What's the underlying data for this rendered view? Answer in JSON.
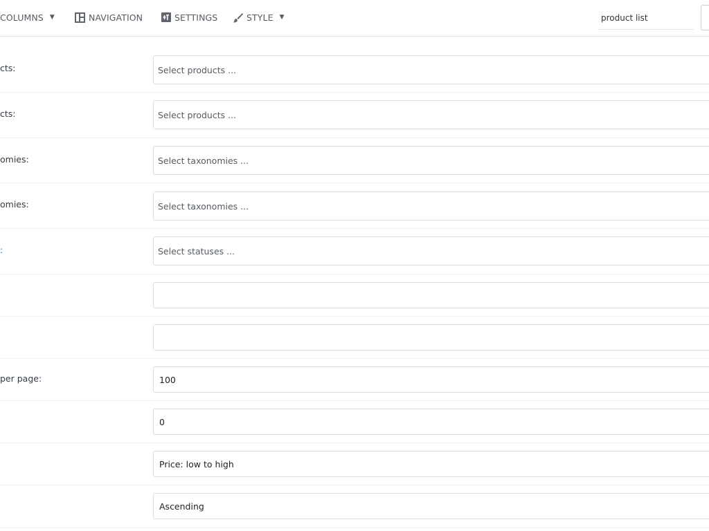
{
  "toolbar": {
    "columns_label": "COLUMNS",
    "navigation_label": "NAVIGATION",
    "settings_label": "SETTINGS",
    "style_label": "STYLE",
    "search_value": "product list"
  },
  "form": {
    "rows": [
      {
        "label": "cts:",
        "placeholder": "Select products ..."
      },
      {
        "label": "cts:",
        "placeholder": "Select products ..."
      },
      {
        "label": "omies:",
        "placeholder": "Select taxonomies ..."
      },
      {
        "label": "omies:",
        "placeholder": "Select taxonomies ..."
      },
      {
        "label": ":",
        "placeholder": "Select statuses ..."
      },
      {
        "label": "",
        "value": ""
      },
      {
        "label": "",
        "value": ""
      },
      {
        "label": "per page:",
        "value": "100"
      },
      {
        "label": "",
        "value": "0"
      },
      {
        "label": "",
        "value": "Price: low to high"
      },
      {
        "label": "",
        "value": "Ascending"
      }
    ]
  }
}
